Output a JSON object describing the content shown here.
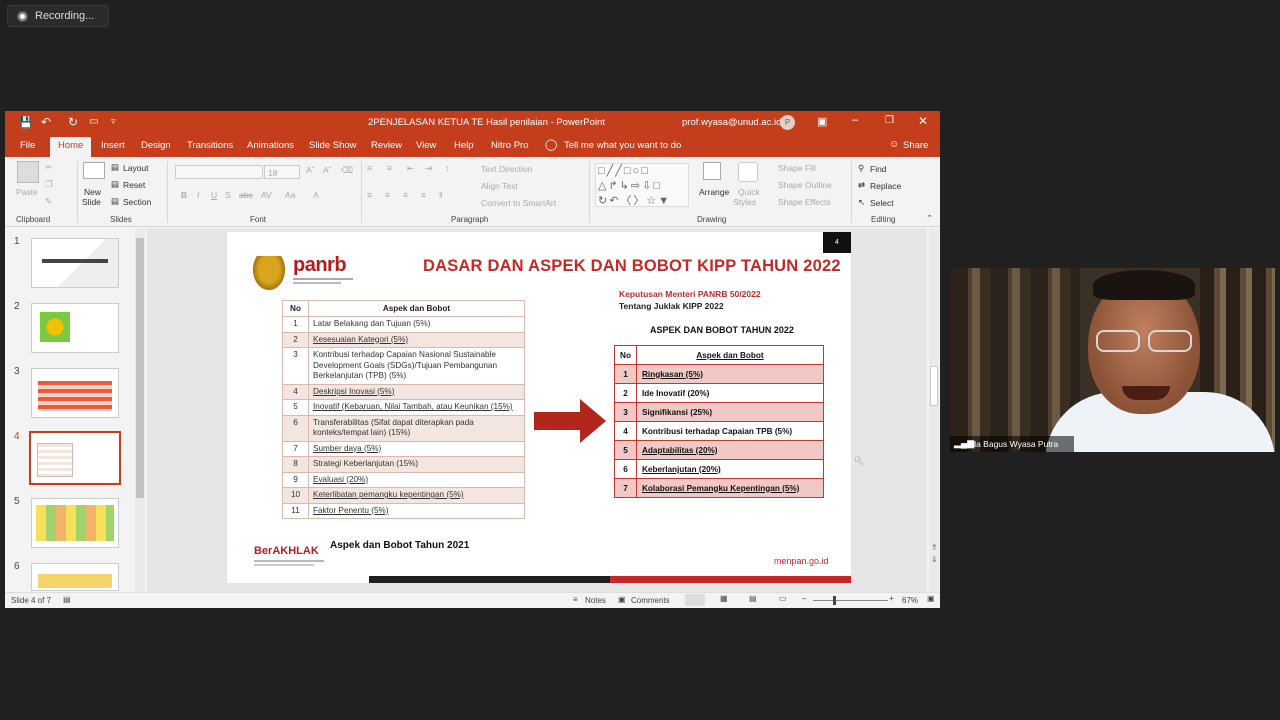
{
  "recording": {
    "label": "Recording..."
  },
  "titlebar": {
    "doc_title": "2PENJELASAN KETUA TE Hasil penilaian  -  PowerPoint",
    "account": "prof.wyasa@unud.ac.id",
    "avatar_initial": "P"
  },
  "tabs": [
    "File",
    "Home",
    "Insert",
    "Design",
    "Transitions",
    "Animations",
    "Slide Show",
    "Review",
    "View",
    "Help",
    "Nitro Pro"
  ],
  "tell_me": "Tell me what you want to do",
  "share": "Share",
  "ribbon": {
    "clipboard": {
      "paste": "Paste",
      "label": "Clipboard"
    },
    "slides": {
      "new_slide": "New",
      "new_slide2": "Slide",
      "layout": "Layout",
      "reset": "Reset",
      "section": "Section",
      "label": "Slides"
    },
    "font": {
      "size": "18",
      "label": "Font"
    },
    "paragraph": {
      "text_direction": "Text Direction",
      "align_text": "Align Text",
      "smartart": "Convert to SmartArt",
      "label": "Paragraph"
    },
    "drawing": {
      "arrange": "Arrange",
      "quick_styles": "Quick",
      "quick_styles2": "Styles",
      "shape_fill": "Shape Fill",
      "shape_outline": "Shape Outline",
      "shape_effects": "Shape Effects",
      "label": "Drawing"
    },
    "editing": {
      "find": "Find",
      "replace": "Replace",
      "select": "Select",
      "label": "Editing"
    }
  },
  "thumbnails": [
    "1",
    "2",
    "3",
    "4",
    "5",
    "6"
  ],
  "slide": {
    "number": "4",
    "logo_text": "panrb",
    "title": "DASAR DAN ASPEK DAN BOBOT KIPP TAHUN 2022",
    "left_table": {
      "headers": [
        "No",
        "Aspek dan Bobot"
      ],
      "rows": [
        [
          "1",
          "Latar Belakang dan Tujuan (5%)"
        ],
        [
          "2",
          "Kesesuaian Kategori (5%)"
        ],
        [
          "3",
          "Kontribusi terhadap Capaian Nasional Sustainable Development Goals (SDGs)/Tujuan Pembangunan Berkelanjutan (TPB) (5%)"
        ],
        [
          "4",
          "Deskripsi Inovasi (5%)"
        ],
        [
          "5",
          "Inovatif (Kebaruan, Nilai Tambah, atau Keunikan (15%)"
        ],
        [
          "6",
          "Transferabilitas (Sifat dapat diterapkan pada konteks/tempat lain) (15%)"
        ],
        [
          "7",
          "Sumber daya (5%)"
        ],
        [
          "8",
          "Strategi Keberlanjutan (15%)"
        ],
        [
          "9",
          "Evaluasi (20%)"
        ],
        [
          "10",
          "Keterlibatan pemangku kepentingan (5%)"
        ],
        [
          "11",
          "Faktor Penentu (5%)"
        ]
      ]
    },
    "decree_line1": "Keputusan Menteri PANRB 50/2022",
    "decree_line2": "Tentang Juklak KIPP 2022",
    "right_heading": "ASPEK DAN BOBOT TAHUN 2022",
    "right_table": {
      "headers": [
        "No",
        "Aspek dan Bobot"
      ],
      "rows": [
        [
          "1",
          "Ringkasan (5%)"
        ],
        [
          "2",
          "Ide Inovatif (20%)"
        ],
        [
          "3",
          "Signifikansi (25%)"
        ],
        [
          "4",
          "Kontribusi terhadap Capaian TPB (5%)"
        ],
        [
          "5",
          "Adaptabilitas (20%)"
        ],
        [
          "6",
          "Keberlanjutan (20%)"
        ],
        [
          "7",
          "Kolaborasi Pemangku Kepentingan (5%)"
        ]
      ]
    },
    "berakhlak": "BerAKHLAK",
    "caption_2021": "Aspek dan Bobot Tahun 2021",
    "footer_url": "menpan.go.id"
  },
  "statusbar": {
    "slide_count": "Slide 4 of 7",
    "notes": "Notes",
    "comments": "Comments",
    "zoom": "67%"
  },
  "video": {
    "participant": "Ida Bagus Wyasa Putra"
  },
  "colors": {
    "accent": "#c43e1c",
    "slide_red": "#c0392b"
  }
}
